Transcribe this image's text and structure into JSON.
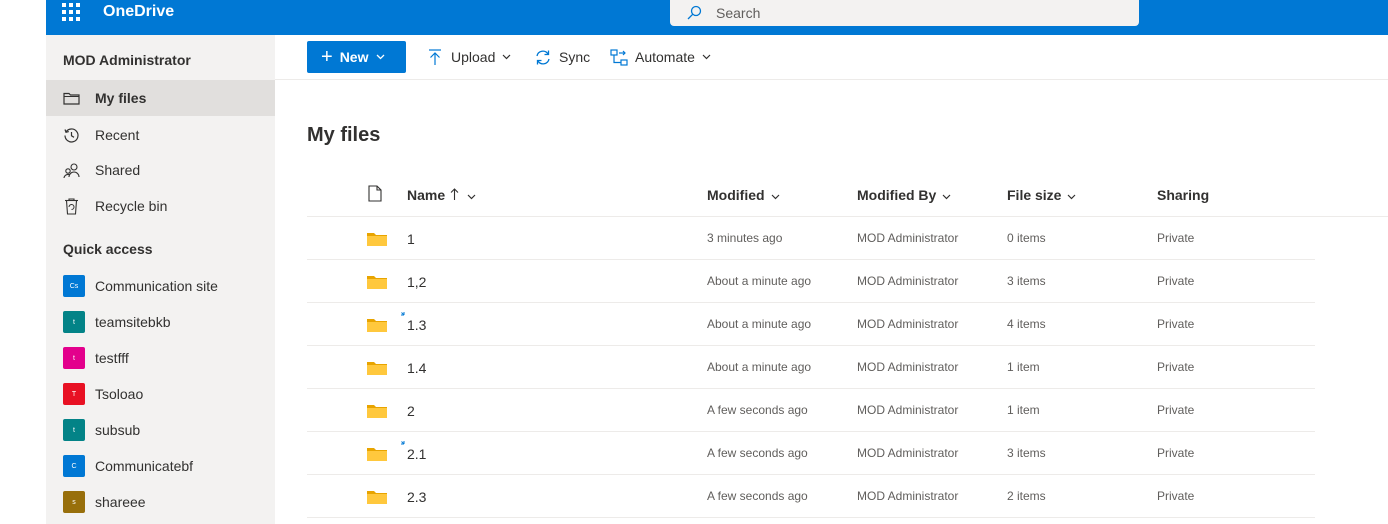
{
  "app": {
    "title": "OneDrive"
  },
  "search": {
    "placeholder": "Search"
  },
  "sidebar": {
    "account": "MOD Administrator",
    "items": [
      {
        "label": "My files",
        "icon": "folder-icon",
        "active": true
      },
      {
        "label": "Recent",
        "icon": "history-icon",
        "active": false
      },
      {
        "label": "Shared",
        "icon": "people-icon",
        "active": false
      },
      {
        "label": "Recycle bin",
        "icon": "trash-icon",
        "active": false
      }
    ],
    "quick_access_heading": "Quick access",
    "sites": [
      {
        "label": "Communication site",
        "initials": "Cs",
        "color": "#0078d4"
      },
      {
        "label": "teamsitebkb",
        "initials": "t",
        "color": "#038387"
      },
      {
        "label": "testfff",
        "initials": "t",
        "color": "#e3008c"
      },
      {
        "label": "Tsoloao",
        "initials": "T",
        "color": "#e81123"
      },
      {
        "label": "subsub",
        "initials": "t",
        "color": "#038387"
      },
      {
        "label": "Communicatebf",
        "initials": "C",
        "color": "#0078d4"
      },
      {
        "label": "shareee",
        "initials": "s",
        "color": "#986f0b"
      }
    ]
  },
  "commands": {
    "new": "New",
    "upload": "Upload",
    "sync": "Sync",
    "automate": "Automate"
  },
  "page_title": "My files",
  "columns": {
    "name": "Name",
    "modified": "Modified",
    "modified_by": "Modified By",
    "file_size": "File size",
    "sharing": "Sharing"
  },
  "rows": [
    {
      "name": "1",
      "modified": "3 minutes ago",
      "modified_by": "MOD Administrator",
      "size": "0 items",
      "sharing": "Private",
      "syncing": false
    },
    {
      "name": "1,2",
      "modified": "About a minute ago",
      "modified_by": "MOD Administrator",
      "size": "3 items",
      "sharing": "Private",
      "syncing": false
    },
    {
      "name": "1.3",
      "modified": "About a minute ago",
      "modified_by": "MOD Administrator",
      "size": "4 items",
      "sharing": "Private",
      "syncing": true
    },
    {
      "name": "1.4",
      "modified": "About a minute ago",
      "modified_by": "MOD Administrator",
      "size": "1 item",
      "sharing": "Private",
      "syncing": false
    },
    {
      "name": "2",
      "modified": "A few seconds ago",
      "modified_by": "MOD Administrator",
      "size": "1 item",
      "sharing": "Private",
      "syncing": false
    },
    {
      "name": "2.1",
      "modified": "A few seconds ago",
      "modified_by": "MOD Administrator",
      "size": "3 items",
      "sharing": "Private",
      "syncing": true
    },
    {
      "name": "2.3",
      "modified": "A few seconds ago",
      "modified_by": "MOD Administrator",
      "size": "2 items",
      "sharing": "Private",
      "syncing": false
    }
  ],
  "colors": {
    "brand": "#0078d4",
    "folder": "#ffb900",
    "sidebar_bg": "#f3f2f1"
  }
}
